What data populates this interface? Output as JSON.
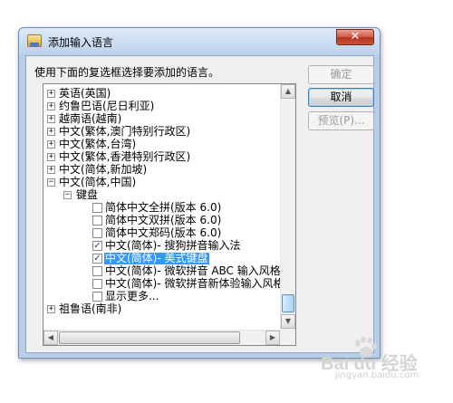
{
  "dialog": {
    "title": "添加输入语言",
    "close_glyph": "✕",
    "prompt": "使用下面的复选框选择要添加的语言。"
  },
  "buttons": {
    "ok": "确定",
    "cancel": "取消",
    "preview": "预览(P)..."
  },
  "tree": {
    "languages": [
      {
        "label": "英语(英国)",
        "toggle": "+"
      },
      {
        "label": "约鲁巴语(尼日利亚)",
        "toggle": "+"
      },
      {
        "label": "越南语(越南)",
        "toggle": "+"
      },
      {
        "label": "中文(繁体,澳门特别行政区)",
        "toggle": "+"
      },
      {
        "label": "中文(繁体,台湾)",
        "toggle": "+"
      },
      {
        "label": "中文(繁体,香港特别行政区)",
        "toggle": "+"
      },
      {
        "label": "中文(简体,新加坡)",
        "toggle": "+"
      },
      {
        "label": "中文(简体,中国)",
        "toggle": "−"
      }
    ],
    "keyboard_group": {
      "label": "键盘",
      "toggle": "−"
    },
    "keyboards": [
      {
        "label": "简体中文全拼(版本 6.0)",
        "checked": false,
        "mark": ""
      },
      {
        "label": "简体中文双拼(版本 6.0)",
        "checked": false,
        "mark": ""
      },
      {
        "label": "简体中文郑码(版本 6.0)",
        "checked": false,
        "mark": ""
      },
      {
        "label": "中文(简体)- 搜狗拼音输入法",
        "checked": true,
        "mark": "✓"
      },
      {
        "label": "中文(简体)- 美式键盘",
        "checked": true,
        "mark": "✓"
      },
      {
        "label": "中文(简体)- 微软拼音 ABC 输入风格",
        "checked": false,
        "mark": ""
      },
      {
        "label": "中文(简体)- 微软拼音新体验输入风格",
        "checked": false,
        "mark": ""
      }
    ],
    "show_more": {
      "label": "显示更多...",
      "checked": false
    },
    "last_language": {
      "label": "祖鲁语(南非)",
      "toggle": "+"
    },
    "scroll_up": "▲",
    "scroll_down": "▼",
    "scroll_left": "◀",
    "scroll_right": "▶"
  },
  "watermark": {
    "brand": "Bai du 经验",
    "url": "jingyan.baidu.com"
  },
  "colors": {
    "selection": "#3399ff",
    "close_button": "#c6523f",
    "title_gradient_top": "#dce9f7"
  }
}
